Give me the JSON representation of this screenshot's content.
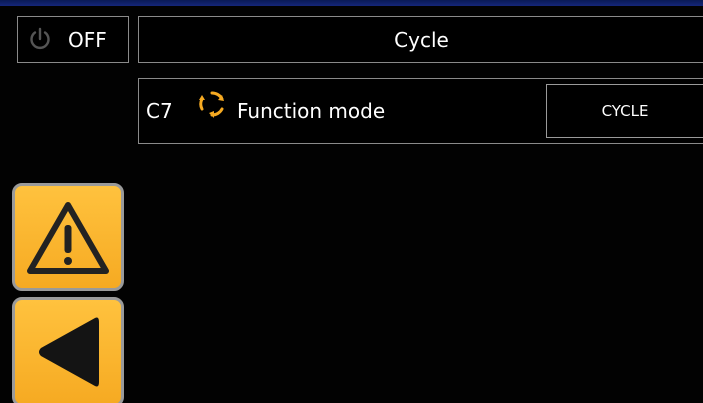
{
  "power": {
    "icon": "power-icon",
    "label": "OFF"
  },
  "header": {
    "title": "Cycle"
  },
  "parameter": {
    "code": "C7",
    "icon": "cycle-icon",
    "name": "Function mode",
    "value": "CYCLE"
  },
  "sidebar": {
    "warning_icon": "warning-icon",
    "back_icon": "back-arrow-icon"
  },
  "colors": {
    "accent_orange": "#f6aa22",
    "border_gray": "#8a8a8a",
    "background": "#000000",
    "top_strip_blue": "#14267a"
  }
}
